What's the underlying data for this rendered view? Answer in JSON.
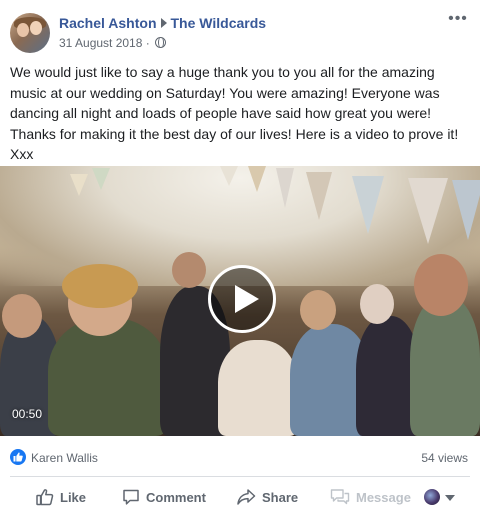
{
  "post": {
    "author": "Rachel Ashton",
    "target_page": "The Wildcards",
    "date": "31 August 2018",
    "privacy_icon": "globe-icon",
    "separator": "·",
    "more_icon": "more-options-icon",
    "more_label": "•••",
    "message": "We would just like to say a huge thank you to you all for the amazing music at our wedding on Saturday! You were amazing! Everyone was dancing all night and loads of people have said how great you were! Thanks for making it the best day of our lives! Here is a video to prove it! Xxx"
  },
  "video": {
    "duration": "00:50",
    "play_icon": "play-icon"
  },
  "reactions": {
    "reaction_icon": "like-reaction-icon",
    "reactor": "Karen Wallis",
    "views": "54 views"
  },
  "actions": {
    "like": "Like",
    "comment": "Comment",
    "share": "Share",
    "message": "Message"
  },
  "colors": {
    "link_blue": "#385898",
    "like_blue": "#1877f2",
    "secondary_text": "#606770",
    "disabled_text": "#bec3c9"
  }
}
